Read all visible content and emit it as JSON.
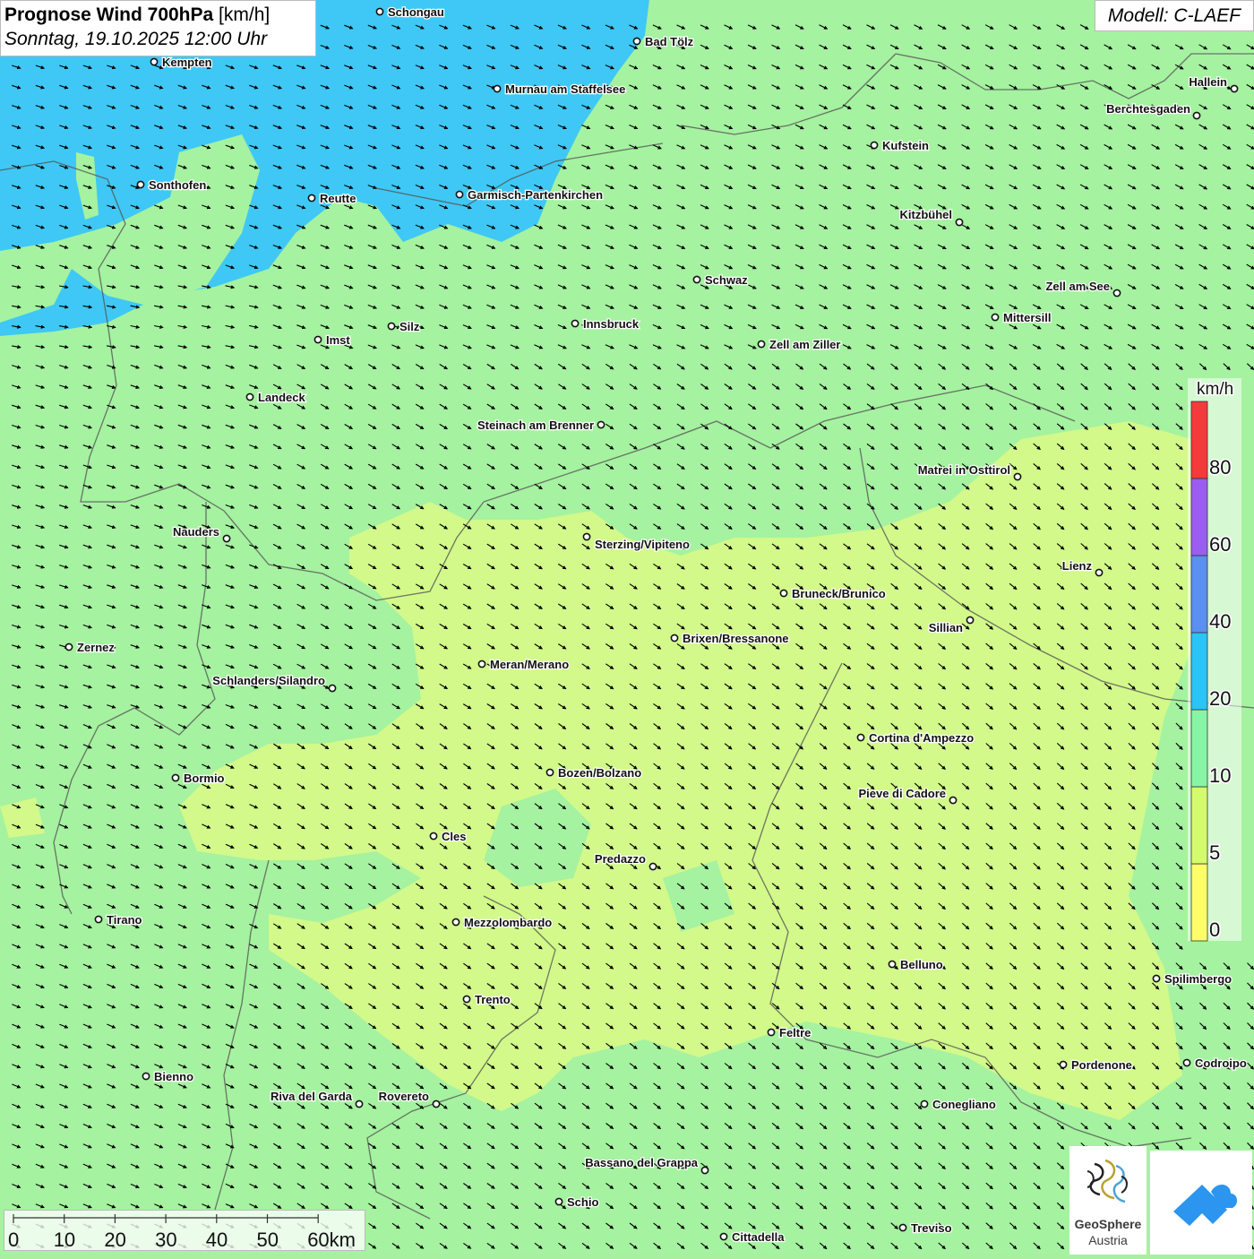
{
  "header": {
    "title_bold": "Prognose Wind 700hPa",
    "title_unit": "[km/h]",
    "datetime": "Sonntag, 19.10.2025 12:00 Uhr"
  },
  "model": "Modell: C-LAEF",
  "legend": {
    "unit": "km/h",
    "ticks": [
      "0",
      "5",
      "10",
      "20",
      "40",
      "60",
      "80"
    ],
    "colors": [
      "#fdfd6a",
      "#d4fb6e",
      "#88f5a6",
      "#2bc4f6",
      "#5b8ff0",
      "#9a5df0",
      "#f43a3a"
    ]
  },
  "scale_bar": {
    "labels": [
      "0",
      "10",
      "20",
      "30",
      "40",
      "50",
      "60km"
    ]
  },
  "cities": [
    {
      "name": "Schongau"
    },
    {
      "name": "Bad Tölz"
    },
    {
      "name": "Kempten"
    },
    {
      "name": "Murnau am Staffelsee"
    },
    {
      "name": "Hallein"
    },
    {
      "name": "Berchtesgaden"
    },
    {
      "name": "Kufstein"
    },
    {
      "name": "Sonthofen"
    },
    {
      "name": "Reutte"
    },
    {
      "name": "Garmisch-Partenkirchen"
    },
    {
      "name": "Kitzbühel"
    },
    {
      "name": "Schwaz"
    },
    {
      "name": "Zell am See"
    },
    {
      "name": "Mittersill"
    },
    {
      "name": "Innsbruck"
    },
    {
      "name": "Silz"
    },
    {
      "name": "Imst"
    },
    {
      "name": "Zell am Ziller"
    },
    {
      "name": "Landeck"
    },
    {
      "name": "Steinach am Brenner"
    },
    {
      "name": "Matrei in Osttirol"
    },
    {
      "name": "Nauders"
    },
    {
      "name": "Sterzing/Vipiteno"
    },
    {
      "name": "Lienz"
    },
    {
      "name": "Bruneck/Brunico"
    },
    {
      "name": "Sillian"
    },
    {
      "name": "Zernez"
    },
    {
      "name": "Brixen/Bressanone"
    },
    {
      "name": "Meran/Merano"
    },
    {
      "name": "Schlanders/Silandro"
    },
    {
      "name": "Cortina d'Ampezzo"
    },
    {
      "name": "Bozen/Bolzano"
    },
    {
      "name": "Bormio"
    },
    {
      "name": "Pieve di Cadore"
    },
    {
      "name": "Cles"
    },
    {
      "name": "Predazzo"
    },
    {
      "name": "Tirano"
    },
    {
      "name": "Mezzolombardo"
    },
    {
      "name": "Belluno"
    },
    {
      "name": "Spilimbergo"
    },
    {
      "name": "Trento"
    },
    {
      "name": "Feltre"
    },
    {
      "name": "Pordenone"
    },
    {
      "name": "Codroipo"
    },
    {
      "name": "Bienno"
    },
    {
      "name": "Riva del Garda"
    },
    {
      "name": "Rovereto"
    },
    {
      "name": "Conegliano"
    },
    {
      "name": "Bassano del Grappa"
    },
    {
      "name": "Schio"
    },
    {
      "name": "Treviso"
    },
    {
      "name": "Cittadella"
    }
  ],
  "logos": {
    "geosphere_line1": "GeoSphere",
    "geosphere_line2": "Austria"
  }
}
